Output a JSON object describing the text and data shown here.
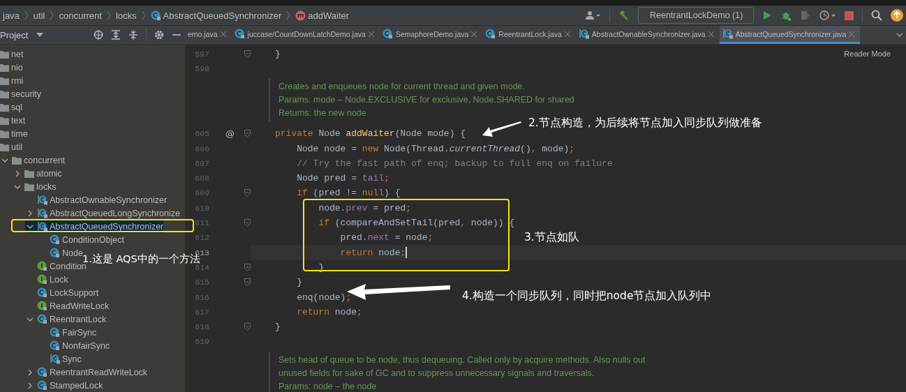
{
  "breadcrumb": [
    {
      "text": "java",
      "kind": "package"
    },
    {
      "text": "util",
      "kind": "package"
    },
    {
      "text": "concurrent",
      "kind": "package"
    },
    {
      "text": "locks",
      "kind": "package"
    },
    {
      "text": "AbstractQueuedSynchronizer",
      "kind": "class"
    },
    {
      "text": "addWaiter",
      "kind": "method"
    }
  ],
  "toolbar": {
    "run_config": "ReentrantLockDemo (1)"
  },
  "project_panel": {
    "title": "Project",
    "tree": [
      {
        "label": "net",
        "kind": "folder",
        "selected": false
      },
      {
        "label": "nio",
        "kind": "folder",
        "selected": false
      },
      {
        "label": "rmi",
        "kind": "folder",
        "selected": false
      },
      {
        "label": "security",
        "kind": "folder",
        "selected": false
      },
      {
        "label": "sql",
        "kind": "folder",
        "selected": false
      },
      {
        "label": "text",
        "kind": "folder",
        "selected": false
      },
      {
        "label": "time",
        "kind": "folder",
        "selected": false
      },
      {
        "label": "util",
        "kind": "folder",
        "selected": false,
        "children": [
          {
            "label": "concurrent",
            "kind": "folder",
            "selected": false,
            "expanded": true,
            "children": [
              {
                "label": "atomic",
                "kind": "folder",
                "selected": false,
                "expanded": false
              },
              {
                "label": "locks",
                "kind": "folder",
                "selected": false,
                "expanded": true,
                "children": [
                  {
                    "label": "AbstractOwnableSynchronizer",
                    "kind": "abstract-class",
                    "selected": false
                  },
                  {
                    "label": "AbstractQueuedLongSynchronize",
                    "kind": "abstract-class",
                    "selected": false,
                    "expanded": false
                  },
                  {
                    "label": "AbstractQueuedSynchronizer",
                    "kind": "abstract-class",
                    "selected": true,
                    "expanded": true,
                    "children": [
                      {
                        "label": "ConditionObject",
                        "kind": "class",
                        "selected": false
                      },
                      {
                        "label": "Node",
                        "kind": "class",
                        "selected": false
                      }
                    ]
                  },
                  {
                    "label": "Condition",
                    "kind": "interface",
                    "selected": false
                  },
                  {
                    "label": "Lock",
                    "kind": "interface",
                    "selected": false
                  },
                  {
                    "label": "LockSupport",
                    "kind": "class",
                    "selected": false
                  },
                  {
                    "label": "ReadWriteLock",
                    "kind": "interface",
                    "selected": false
                  },
                  {
                    "label": "ReentrantLock",
                    "kind": "class",
                    "selected": false,
                    "expanded": true,
                    "children": [
                      {
                        "label": "FairSync",
                        "kind": "class",
                        "selected": false
                      },
                      {
                        "label": "NonfairSync",
                        "kind": "class",
                        "selected": false
                      },
                      {
                        "label": "Sync",
                        "kind": "abstract-class",
                        "selected": false
                      }
                    ]
                  },
                  {
                    "label": "ReentrantReadWriteLock",
                    "kind": "class",
                    "selected": false,
                    "expanded": false
                  },
                  {
                    "label": "StampedLock",
                    "kind": "class",
                    "selected": false,
                    "expanded": false
                  }
                ]
              }
            ]
          }
        ]
      }
    ]
  },
  "tabs": [
    {
      "label": "emo.java",
      "kind": "file",
      "selected": false
    },
    {
      "label": "juccase/CountDownLatchDemo.java",
      "kind": "class",
      "selected": false
    },
    {
      "label": "SemaphoreDemo.java",
      "kind": "class",
      "selected": false
    },
    {
      "label": "ReentrantLock.java",
      "kind": "class",
      "selected": false
    },
    {
      "label": "AbstractOwnableSynchronizer.java",
      "kind": "abstract-class",
      "selected": false
    },
    {
      "label": "AbstractQueuedSynchronizer.java",
      "kind": "abstract-class",
      "selected": true
    }
  ],
  "reader_mode": "Reader Mode",
  "code": [
    {
      "kind": "line",
      "number": "597",
      "fold": true,
      "current": false,
      "tokens": [
        {
          "text": "}",
          "kind": "plain"
        }
      ]
    },
    {
      "kind": "line",
      "number": "598",
      "fold": false,
      "current": false
    },
    {
      "kind": "doc",
      "text": [
        "Creates and enqueues node for current thread and given mode.",
        "Params:  mode – Node.EXCLUSIVE for exclusive, Node.SHARED for shared",
        "Returns: the new node"
      ]
    },
    {
      "kind": "line",
      "number": "605",
      "gutter_mark": "@",
      "fold": true,
      "current": false,
      "tokens": [
        {
          "text": "private",
          "kind": "keyword"
        },
        {
          "text": " Node ",
          "kind": "plain"
        },
        {
          "text": "addWaiter",
          "kind": "method"
        },
        {
          "text": "(Node mode) {",
          "kind": "plain"
        }
      ]
    },
    {
      "kind": "line",
      "number": "606",
      "fold": false,
      "current": false,
      "tokens": [
        {
          "text": "    Node node = ",
          "kind": "plain"
        },
        {
          "text": "new",
          "kind": "keyword"
        },
        {
          "text": " Node(Thread.",
          "kind": "plain"
        },
        {
          "text": "currentThread",
          "kind": "static"
        },
        {
          "text": "()",
          "kind": "plain"
        },
        {
          "text": ",",
          "kind": "keyword"
        },
        {
          "text": " mode)",
          "kind": "plain"
        },
        {
          "text": ";",
          "kind": "keyword"
        }
      ]
    },
    {
      "kind": "line",
      "number": "607",
      "fold": false,
      "current": false,
      "tokens": [
        {
          "text": "    // Try the fast path of enq; backup to full enq on failure",
          "kind": "comment"
        }
      ]
    },
    {
      "kind": "line",
      "number": "608",
      "fold": false,
      "current": false,
      "tokens": [
        {
          "text": "    Node pred = ",
          "kind": "plain"
        },
        {
          "text": "tail",
          "kind": "field"
        },
        {
          "text": ";",
          "kind": "keyword"
        }
      ]
    },
    {
      "kind": "line",
      "number": "609",
      "fold": true,
      "current": false,
      "tokens": [
        {
          "text": "    if",
          "kind": "keyword"
        },
        {
          "text": " (pred != ",
          "kind": "plain"
        },
        {
          "text": "null",
          "kind": "keyword"
        },
        {
          "text": ") {",
          "kind": "plain"
        }
      ]
    },
    {
      "kind": "line",
      "number": "610",
      "fold": false,
      "current": false,
      "tokens": [
        {
          "text": "        node.",
          "kind": "plain"
        },
        {
          "text": "prev",
          "kind": "field"
        },
        {
          "text": " = pred",
          "kind": "plain"
        },
        {
          "text": ";",
          "kind": "keyword"
        }
      ]
    },
    {
      "kind": "line",
      "number": "611",
      "fold": true,
      "current": false,
      "tokens": [
        {
          "text": "        if",
          "kind": "keyword"
        },
        {
          "text": " (compareAndSetTail(pred",
          "kind": "plain"
        },
        {
          "text": ",",
          "kind": "keyword"
        },
        {
          "text": " node)) {",
          "kind": "plain"
        }
      ]
    },
    {
      "kind": "line",
      "number": "612",
      "fold": false,
      "current": false,
      "tokens": [
        {
          "text": "            pred.",
          "kind": "plain"
        },
        {
          "text": "next",
          "kind": "field"
        },
        {
          "text": " = node",
          "kind": "plain"
        },
        {
          "text": ";",
          "kind": "keyword"
        }
      ]
    },
    {
      "kind": "line",
      "number": "613",
      "fold": false,
      "current": true,
      "tokens": [
        {
          "text": "            return",
          "kind": "keyword"
        },
        {
          "text": " node",
          "kind": "plain"
        },
        {
          "text": ";",
          "kind": "keyword"
        }
      ]
    },
    {
      "kind": "line",
      "number": "614",
      "fold": true,
      "current": false,
      "tokens": [
        {
          "text": "        }",
          "kind": "plain"
        }
      ]
    },
    {
      "kind": "line",
      "number": "615",
      "fold": true,
      "current": false,
      "tokens": [
        {
          "text": "    }",
          "kind": "plain"
        }
      ]
    },
    {
      "kind": "line",
      "number": "616",
      "fold": false,
      "current": false,
      "tokens": [
        {
          "text": "    enq(node)",
          "kind": "plain"
        },
        {
          "text": ";",
          "kind": "keyword"
        }
      ]
    },
    {
      "kind": "line",
      "number": "617",
      "fold": false,
      "current": false,
      "tokens": [
        {
          "text": "    return",
          "kind": "keyword"
        },
        {
          "text": " node",
          "kind": "plain"
        },
        {
          "text": ";",
          "kind": "keyword"
        }
      ]
    },
    {
      "kind": "line",
      "number": "618",
      "fold": true,
      "current": false,
      "tokens": [
        {
          "text": "}",
          "kind": "plain"
        }
      ]
    },
    {
      "kind": "line",
      "number": "619",
      "fold": false,
      "current": false
    },
    {
      "kind": "doc",
      "text": [
        "Sets head of queue to be node, thus dequeuing. Called only by acquire methods. Also nulls out unused fields for sake of GC and to suppress unnecessary signals and traversals.",
        "Params: node – the node"
      ]
    }
  ],
  "annotations": [
    {
      "text": "1.这是 AQS中的一个方法"
    },
    {
      "text": "2.节点构造，为后续将节点加入同步队列做准备"
    },
    {
      "text": "3.节点如队"
    },
    {
      "text": "4.构造一个同步队列，同时把node节点加入队列中"
    }
  ]
}
